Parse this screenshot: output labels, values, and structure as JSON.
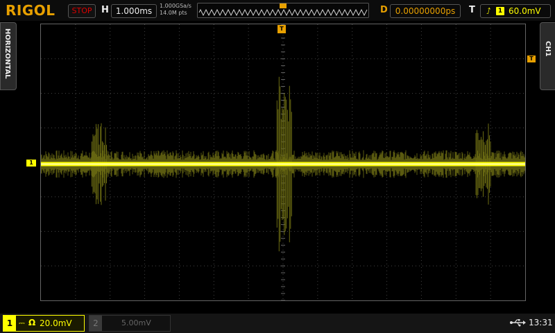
{
  "brand": "RIGOL",
  "acquisition": {
    "status": "STOP"
  },
  "horizontal": {
    "label": "H",
    "timebase": "1.000ms",
    "sample_rate": "1.000GSa/s",
    "memory_depth": "14.0M pts",
    "tab_label": "HORIZONTAL"
  },
  "delay": {
    "label": "D",
    "value": "0.00000000ps"
  },
  "trigger": {
    "label": "T",
    "channel": "1",
    "level": "60.0mV",
    "marker": "T",
    "edge_icon": "rising-edge-icon"
  },
  "channels": {
    "ch1": {
      "number": "1",
      "coupling": "DC",
      "impedance": "Ω",
      "scale": "20.0mV",
      "marker": "1",
      "tab_label": "CH1",
      "color": "#ffff00"
    },
    "ch2": {
      "number": "2",
      "scale": "5.00mV",
      "color": "#00ffff",
      "enabled": false
    }
  },
  "status_bar": {
    "time": "13:31",
    "usb_icon": "usb-icon"
  },
  "colors": {
    "accent": "#e8a000",
    "trace": "#ffff00",
    "stop": "#dd0000"
  },
  "waveform": {
    "description_type": "noise_with_bursts",
    "baseline_divisions_from_center": 0.05,
    "bursts": [
      {
        "center_division": -10.6,
        "width_division": 0.45,
        "amplitude_divisions": 2.4
      },
      {
        "center_division": 0.1,
        "width_division": 0.45,
        "amplitude_divisions": 5.2
      },
      {
        "center_division": 11.6,
        "width_division": 0.45,
        "amplitude_divisions": 2.4
      }
    ]
  }
}
